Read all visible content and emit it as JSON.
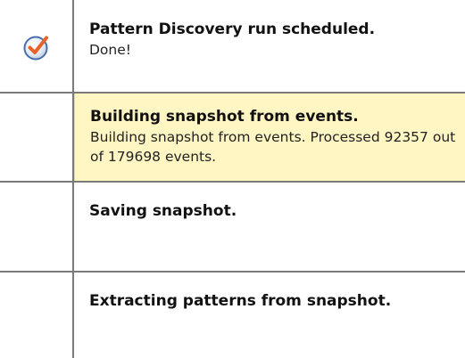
{
  "steps": [
    {
      "title": "Pattern Discovery run scheduled.",
      "description": "Done!",
      "status_icon": "check-circle-icon",
      "highlighted": false
    },
    {
      "title": "Building snapshot from events.",
      "description": "Building snapshot from events. Processed 92357 out of 179698 events.",
      "status_icon": "",
      "highlighted": true,
      "processed": 92357,
      "total": 179698
    },
    {
      "title": "Saving snapshot.",
      "description": "",
      "status_icon": "",
      "highlighted": false
    },
    {
      "title": "Extracting patterns from snapshot.",
      "description": "",
      "status_icon": "",
      "highlighted": false
    }
  ],
  "colors": {
    "highlight_bg": "#fff6c4",
    "divider": "#7a7a7a",
    "check_orange": "#e8622a",
    "check_ring": "#4a6fa8"
  }
}
